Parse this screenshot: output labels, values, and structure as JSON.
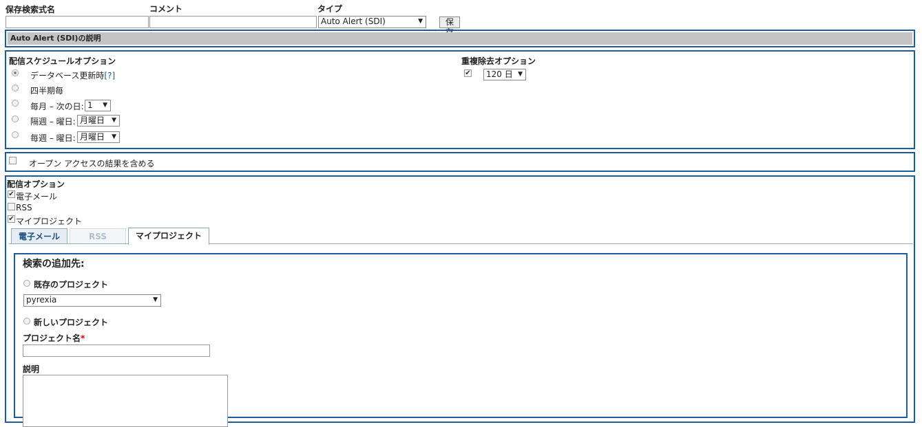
{
  "header": {
    "saved_search_name_label": "保存検索式名",
    "comment_label": "コメント",
    "type_label": "タイプ",
    "saved_search_name_value": "",
    "comment_value": "",
    "type_selected": "Auto Alert (SDI)",
    "save_button": "保存"
  },
  "description_bar": {
    "title": "Auto Alert (SDI)の説明"
  },
  "schedule": {
    "title": "配信スケジュールオプション",
    "options": {
      "database_update": "データベース更新時",
      "help": "[?]",
      "quarterly": "四半期毎",
      "monthly": "毎月 – 次の日:",
      "biweekly": "隔週 – 曜日:",
      "weekly": "毎週 – 曜日:"
    },
    "monthly_day": "1",
    "biweekly_day": "月曜日",
    "weekly_day": "月曜日",
    "selected": "database_update"
  },
  "dedup": {
    "title": "重複除去オプション",
    "checked": true,
    "days": "120 日"
  },
  "open_access": {
    "label": "オープン アクセスの結果を含める",
    "checked": false
  },
  "delivery": {
    "title": "配信オプション",
    "email": {
      "label": "電子メール",
      "checked": true
    },
    "rss": {
      "label": "RSS",
      "checked": false
    },
    "my_project": {
      "label": "マイプロジェクト",
      "checked": true
    }
  },
  "tabs": {
    "email": "電子メール",
    "rss": "RSS",
    "my_project": "マイプロジェクト",
    "active": "my_project"
  },
  "project_panel": {
    "title": "検索の追加先:",
    "existing_label": "既存のプロジェクト",
    "existing_selected": "pyrexia",
    "new_label": "新しいプロジェクト",
    "project_name_label": "プロジェクト名",
    "required_mark": "*",
    "project_name_value": "",
    "description_label": "説明",
    "description_value": ""
  },
  "colors": {
    "border": "#1d5a99",
    "bar_gray": "#c4c4c4",
    "tab_text": "#1d4f80"
  }
}
